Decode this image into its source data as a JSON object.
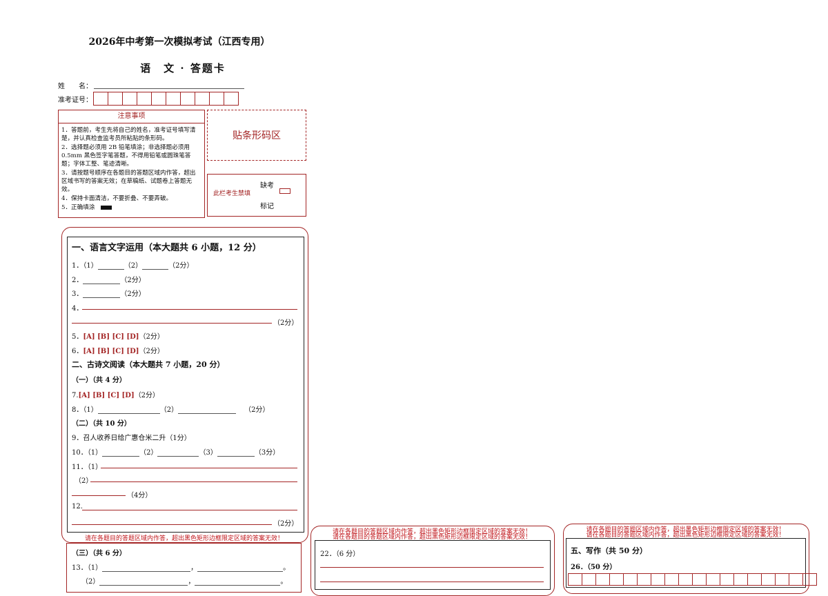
{
  "header": {
    "title": "2026年中考第一次模拟考试（江西专用）",
    "subtitle": "语　文 · 答题卡",
    "name_label": "姓　　名：",
    "id_label": "准考证号："
  },
  "notice": {
    "heading": "注意事项",
    "items": [
      "1．答题前，考生先将自己的姓名，准考证号填写清楚，并认真检查监考员所粘贴的条形码。",
      "2．选择题必须用 2B 铅笔填涂；非选择题必须用 0.5mm 黑色签字笔答题，不得用铅笔或圆珠笔答题；字体工整、笔迹清晰。",
      "3．请按题号顺序在各题目的答题区域内作答，超出区域书写的答案无效；在草稿纸、试题卷上答题无效。",
      "4．保持卡面清洁，不要折叠、不要弄破。",
      "5．正确填涂"
    ]
  },
  "barcode_label": "贴条形码区",
  "absent": {
    "note": "此栏考生禁填",
    "top": "缺考",
    "bottom": "标记"
  },
  "section1": {
    "heading": "一、语言文字运用（本大题共 6 小题，12 分）",
    "q1a": "1．（1）",
    "q1b": "（2）",
    "q1c": "（2分）",
    "q2a": "2．",
    "q2b": "（2分）",
    "q3a": "3．",
    "q3b": "（2分）",
    "q4a": "4．",
    "q4b": "（2分）",
    "q5num": "5．",
    "q5opts": "[A] [B] [C] [D]",
    "q5score": "（2分）",
    "q6num": "6．",
    "q6opts": "[A] [B] [C] [D]",
    "q6score": "（2分）"
  },
  "section2": {
    "heading": "二、古诗文阅读（本大题共 7 小题，20 分）",
    "part1": "（一）（共 4 分）",
    "q7num": "7.",
    "q7opts": "[A] [B] [C] [D]",
    "q7score": "（2分）",
    "q8a": "8．（1）",
    "q8b": "（2）",
    "q8c": "（2分）",
    "part2": "（二）（共 10 分）",
    "q9": "9．召人收养日给广惠仓米二升（1分）",
    "q10a": "10．（1）",
    "q10b": "（2）",
    "q10c": "（3）",
    "q10d": "（3分）",
    "q11a": "11．（1）",
    "q11b": "（2）",
    "q11c": "（4分）",
    "q12a": "12.",
    "q12b": "（2分）"
  },
  "warning": "请在各题目的答题区域内作答，超出黑色矩形边框限定区域的答案无效！",
  "section3": {
    "part3": "（三）（共 6 分）",
    "q13a": "13．（1）",
    "q13b": "，",
    "q13c": "。",
    "q13d": "（2）",
    "q13e": "，",
    "q13f": "。"
  },
  "q22": "22．（6 分）",
  "section5": {
    "heading": "五、写作（共 50 分）",
    "q26": "26．（50 分）"
  }
}
